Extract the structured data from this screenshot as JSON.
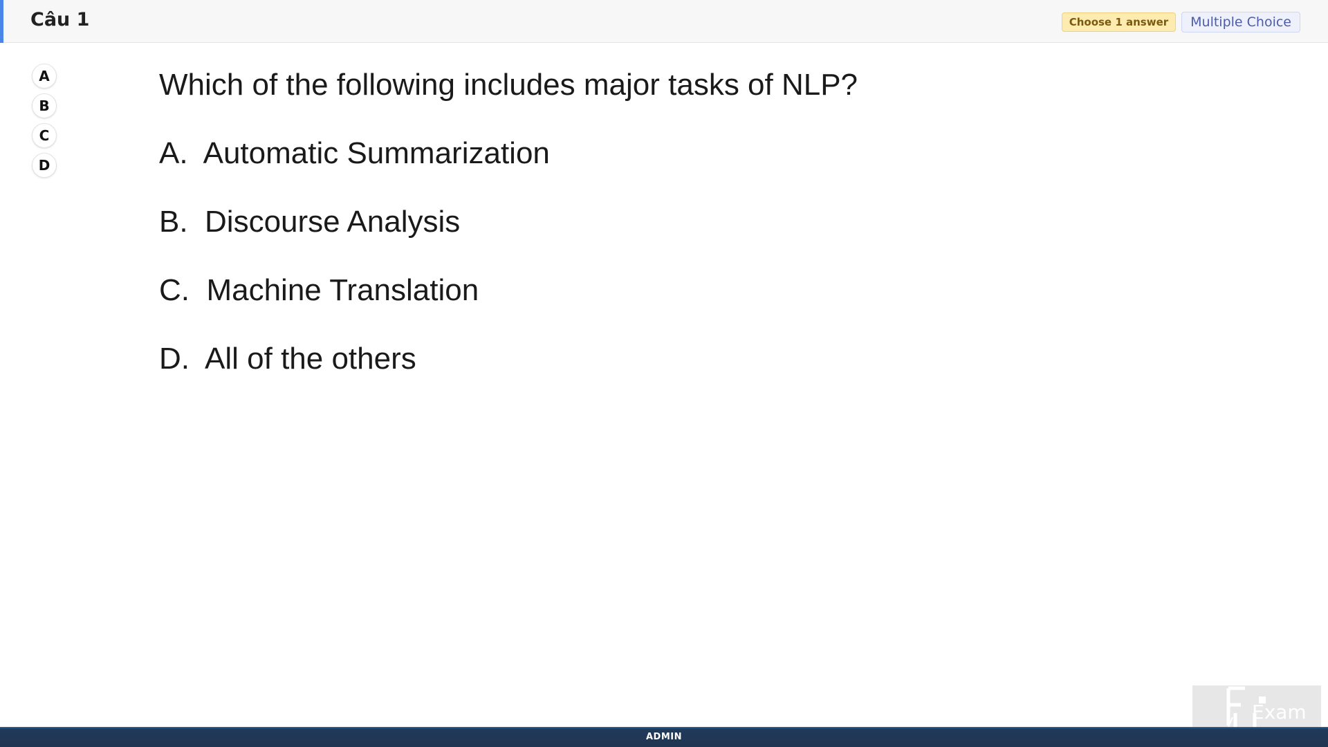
{
  "header": {
    "question_number": "Câu 1",
    "choose_badge": "Choose 1 answer",
    "type_badge": "Multiple Choice"
  },
  "options": [
    {
      "label": "A"
    },
    {
      "label": "B"
    },
    {
      "label": "C"
    },
    {
      "label": "D"
    }
  ],
  "question": {
    "text": "Which of the following includes major tasks of NLP?",
    "answers": [
      "A.  Automatic Summarization",
      "B.  Discourse Analysis",
      "C.  Machine Translation",
      "D.  All of the others"
    ]
  },
  "footer": {
    "label": "ADMIN"
  },
  "logo": {
    "text": "Exam",
    "icon": "fu-exam-logo-icon"
  },
  "colors": {
    "accent": "#4a86e8",
    "choose_badge_bg": "#fdebb0",
    "type_badge_text": "#4d5ca8",
    "footer_bg": "#1f3552"
  }
}
